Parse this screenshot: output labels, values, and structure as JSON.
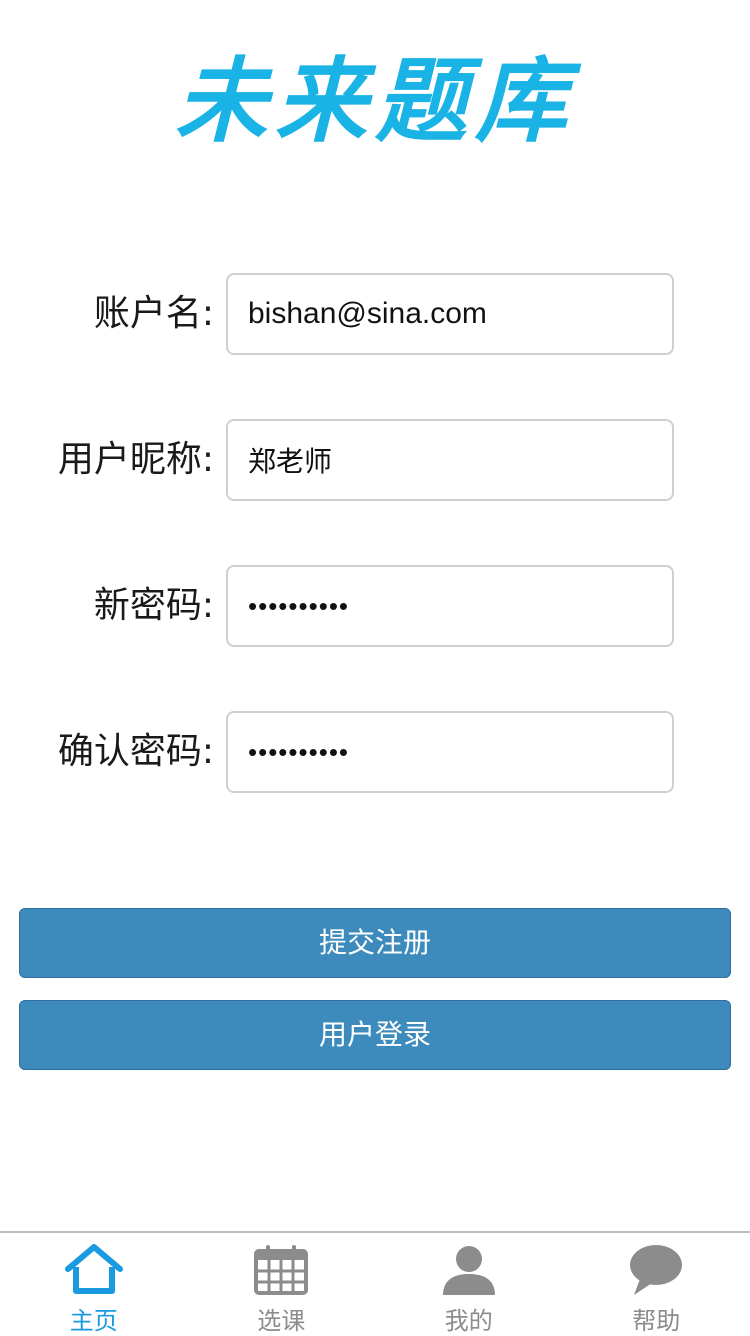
{
  "app": {
    "logo_text": "未来题库"
  },
  "form": {
    "account": {
      "label": "账户名:",
      "value": "bishan@sina.com"
    },
    "nickname": {
      "label": "用户昵称:",
      "value": "郑老师"
    },
    "new_password": {
      "label": "新密码:",
      "value": "••••••••••"
    },
    "confirm_password": {
      "label": "确认密码:",
      "value": "••••••••••"
    }
  },
  "buttons": {
    "submit_label": "提交注册",
    "login_label": "用户登录"
  },
  "tabbar": {
    "items": [
      {
        "label": "主页",
        "icon": "home-icon",
        "active": true
      },
      {
        "label": "选课",
        "icon": "calendar-icon",
        "active": false
      },
      {
        "label": "我的",
        "icon": "user-icon",
        "active": false
      },
      {
        "label": "帮助",
        "icon": "chat-bubble-icon",
        "active": false
      }
    ]
  },
  "colors": {
    "logo": "#1ab3e6",
    "button_bg": "#3d8bbd",
    "tab_active": "#1a9ae0",
    "tab_inactive": "#8c8c8c"
  }
}
